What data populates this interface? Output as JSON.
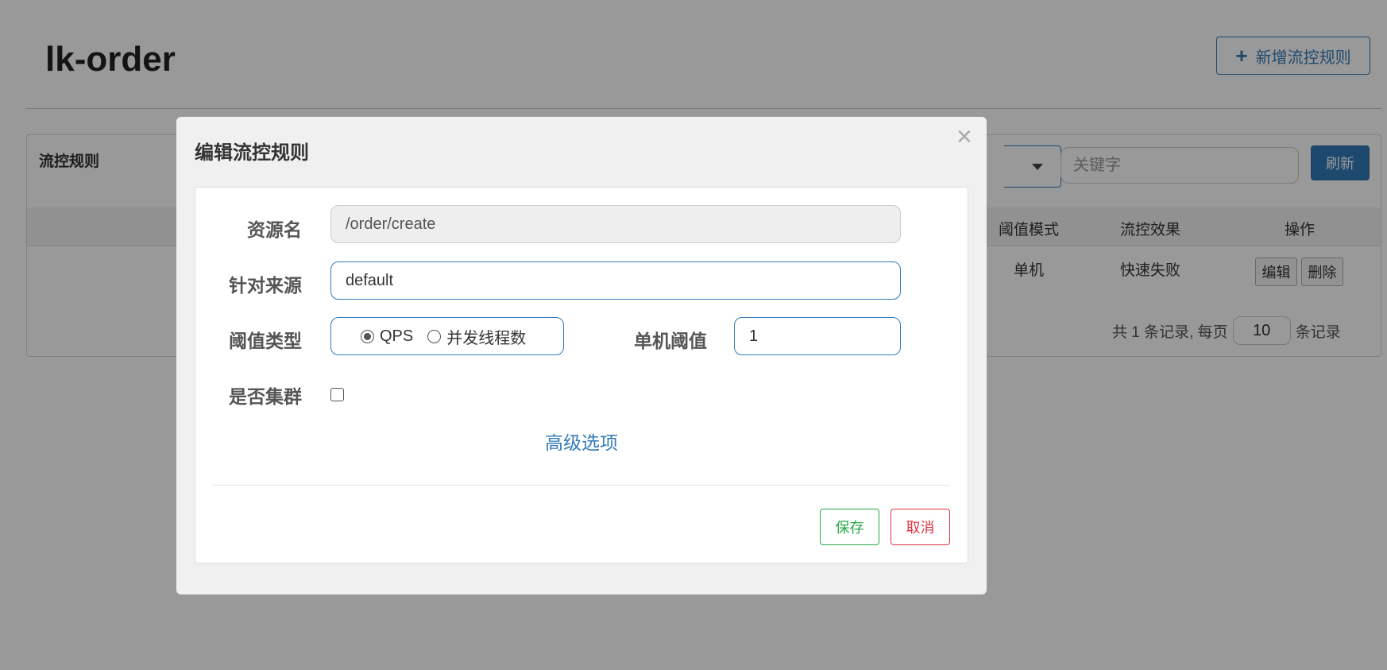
{
  "page": {
    "title": "lk-order",
    "add_rule_label": "新增流控规则"
  },
  "panel": {
    "title": "流控规则",
    "keyword_placeholder": "关键字",
    "refresh_label": "刷新",
    "columns": [
      "阈值模式",
      "流控效果",
      "操作"
    ],
    "row": {
      "threshold_mode": "单机",
      "effect": "快速失败",
      "edit_label": "编辑",
      "delete_label": "删除"
    },
    "pager": {
      "prefix": "共 1 条记录, 每页",
      "page_size": "10",
      "suffix": "条记录"
    }
  },
  "modal": {
    "title": "编辑流控规则",
    "close_label": "×",
    "resource_label": "资源名",
    "resource_value": "/order/create",
    "origin_label": "针对来源",
    "origin_value": "default",
    "threshold_type_label": "阈值类型",
    "threshold_types": [
      "QPS",
      "并发线程数"
    ],
    "threshold_type_selected": "QPS",
    "single_threshold_label": "单机阈值",
    "single_threshold_value": "1",
    "cluster_label": "是否集群",
    "cluster_checked": false,
    "advanced_label": "高级选项",
    "save_label": "保存",
    "cancel_label": "取消"
  },
  "colors": {
    "primary": "#337ab7",
    "success": "#28a745",
    "danger": "#dc3545",
    "overlay": "rgba(0,0,0,0.4)"
  }
}
